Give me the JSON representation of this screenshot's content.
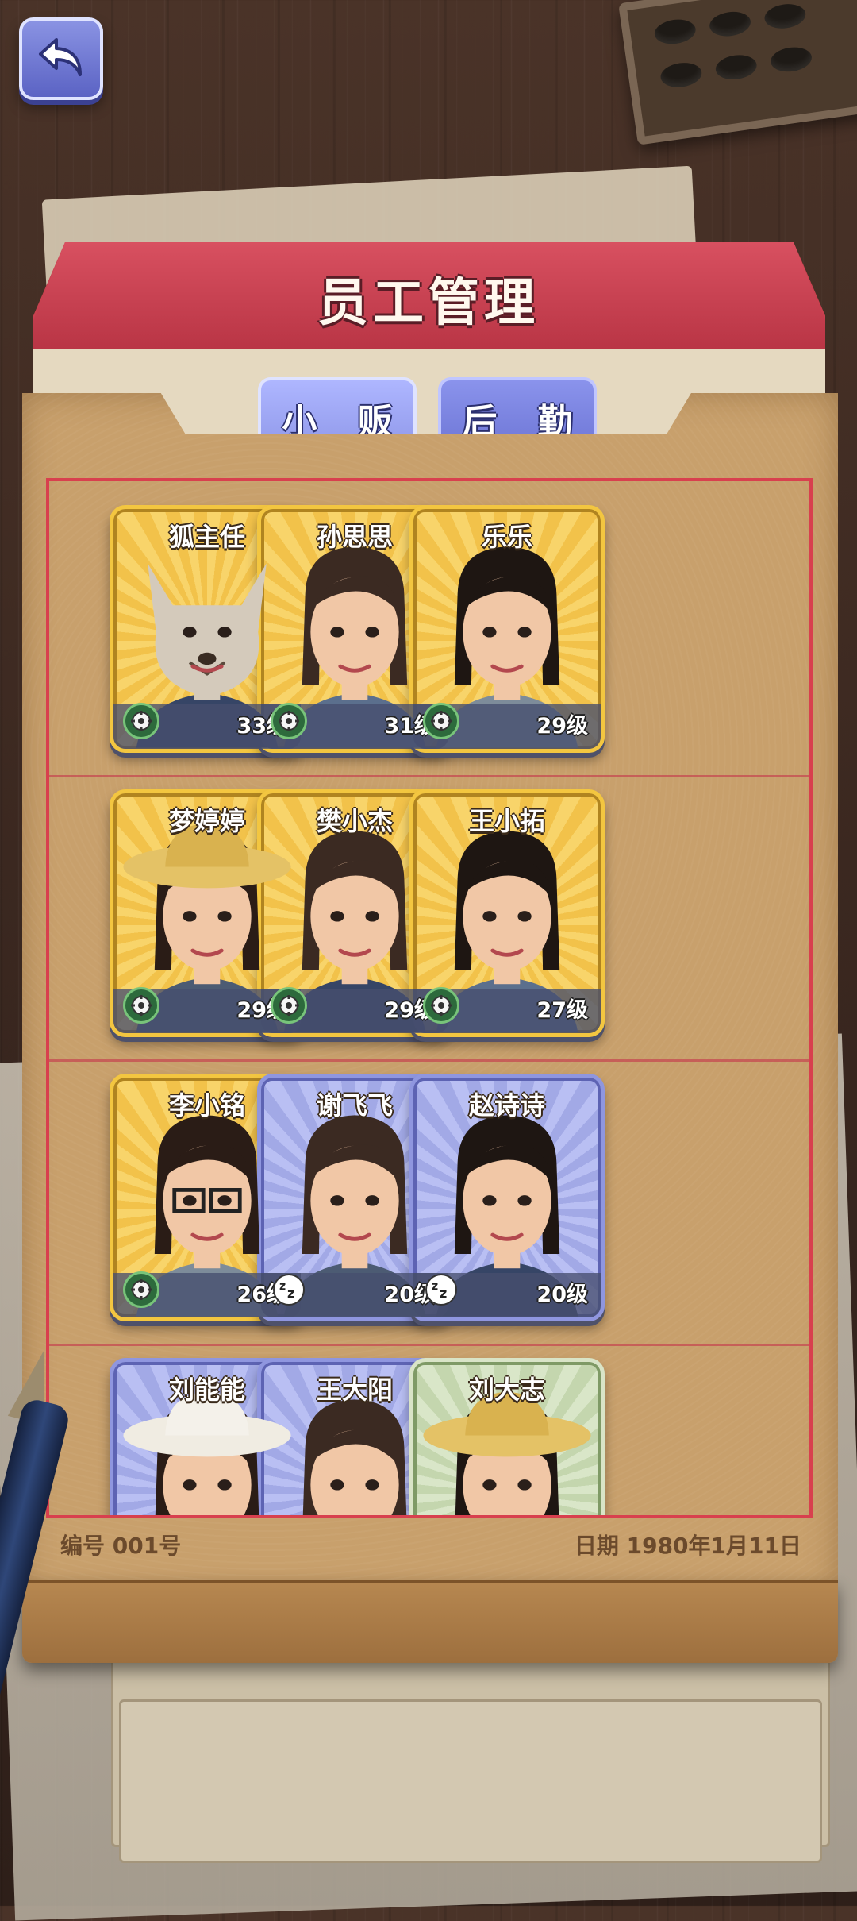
{
  "screen": {
    "title": "员工管理"
  },
  "tabs": [
    {
      "label": "小 贩",
      "selected": true
    },
    {
      "label": "后 勤",
      "selected": false
    }
  ],
  "staff": [
    {
      "name": "狐主任",
      "level": "33级",
      "status": "working",
      "frame": "gold",
      "portrait": "fox"
    },
    {
      "name": "孙思思",
      "level": "31级",
      "status": "working",
      "frame": "gold",
      "portrait": "woman-long-hair"
    },
    {
      "name": "乐乐",
      "level": "29级",
      "status": "working",
      "frame": "gold",
      "portrait": "girl-braid"
    },
    {
      "name": "梦婷婷",
      "level": "29级",
      "status": "working",
      "frame": "gold",
      "portrait": "woman-straw-hat"
    },
    {
      "name": "樊小杰",
      "level": "29级",
      "status": "working",
      "frame": "gold",
      "portrait": "man-dark"
    },
    {
      "name": "王小拓",
      "level": "27级",
      "status": "working",
      "frame": "gold",
      "portrait": "man-smiling"
    },
    {
      "name": "李小铭",
      "level": "26级",
      "status": "working",
      "frame": "gold",
      "portrait": "man-glasses"
    },
    {
      "name": "谢飞飞",
      "level": "20级",
      "status": "resting",
      "frame": "blue",
      "portrait": "woman-bun"
    },
    {
      "name": "赵诗诗",
      "level": "20级",
      "status": "resting",
      "frame": "blue",
      "portrait": "girl-bob"
    },
    {
      "name": "刘能能",
      "level": "",
      "status": "",
      "frame": "blue",
      "portrait": "old-man-hat"
    },
    {
      "name": "王大阳",
      "level": "",
      "status": "",
      "frame": "blue",
      "portrait": "young-man"
    },
    {
      "name": "刘大志",
      "level": "",
      "status": "",
      "frame": "green",
      "portrait": "old-farmer"
    }
  ],
  "footer": {
    "serial": "编号 001号",
    "date": "日期 1980年1月11日"
  },
  "colors": {
    "folder_red": "#c9414f",
    "folder_tan": "#c8a06c",
    "tab_blue": "#8d96e8",
    "card_gold": "#f3c640",
    "card_blue": "#8f96df",
    "card_green": "#d9e4c7"
  }
}
